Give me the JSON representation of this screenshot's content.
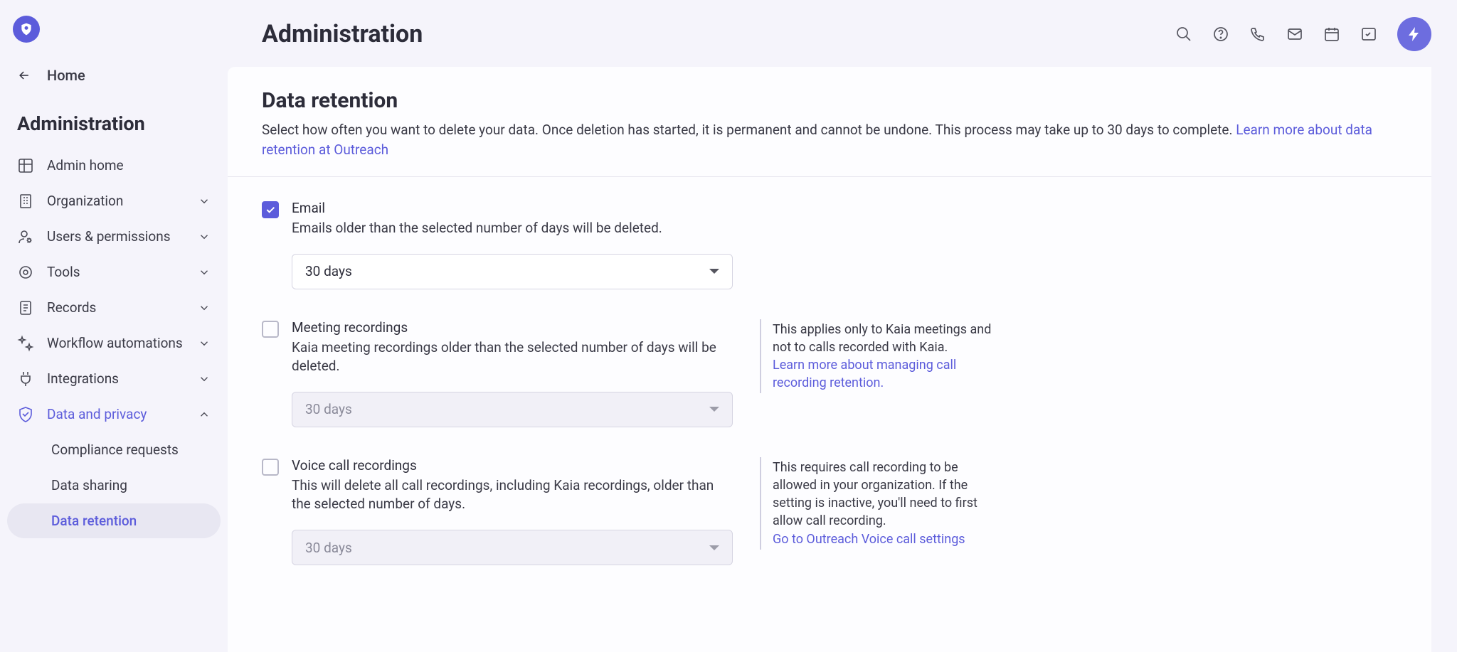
{
  "app_title": "Administration",
  "home_label": "Home",
  "sidebar_title": "Administration",
  "nav": {
    "admin_home": "Admin home",
    "organization": "Organization",
    "users": "Users & permissions",
    "tools": "Tools",
    "records": "Records",
    "workflow": "Workflow automations",
    "integrations": "Integrations",
    "data_privacy": "Data and privacy",
    "compliance": "Compliance requests",
    "data_sharing": "Data sharing",
    "data_retention": "Data retention"
  },
  "page": {
    "title": "Data retention",
    "subtitle": "Select how often you want to delete your data. Once deletion has started, it is permanent and cannot be undone. This process may take up to 30 days to complete. ",
    "learn_link": "Learn more about data retention at Outreach"
  },
  "email": {
    "title": "Email",
    "desc": "Emails older than the selected number of days will be deleted.",
    "value": "30 days"
  },
  "meeting": {
    "title": "Meeting recordings",
    "desc": "Kaia meeting recordings older than the selected number of days will be deleted.",
    "value": "30 days",
    "note_text": "This applies only to Kaia meetings and not to calls recorded with Kaia.",
    "note_link": "Learn more about managing call recording retention."
  },
  "voice": {
    "title": "Voice call recordings",
    "desc": "This will delete all call recordings, including Kaia recordings, older than the selected number of days.",
    "value": "30 days",
    "note_text": "This requires call recording to be allowed in your organization. If the setting is inactive, you'll need to first allow call recording.",
    "note_link": "Go to Outreach Voice call settings"
  }
}
